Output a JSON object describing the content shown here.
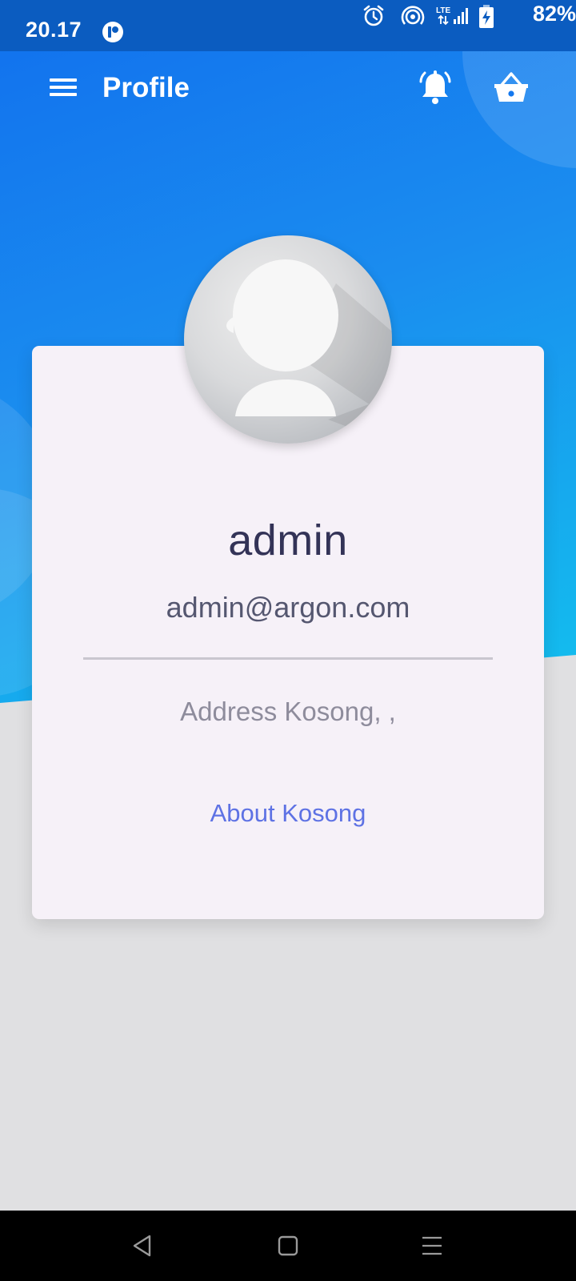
{
  "status_bar": {
    "time": "20.17",
    "battery": "82%",
    "icons": [
      "app-notification-icon",
      "alarm-icon",
      "hotspot-icon",
      "lte-signal-icon",
      "battery-charging-icon"
    ]
  },
  "app_bar": {
    "title": "Profile",
    "menu_icon": "hamburger-menu-icon",
    "notification_icon": "bell-icon",
    "cart_icon": "basket-icon"
  },
  "profile": {
    "name": "admin",
    "email": "admin@argon.com",
    "address": "Address Kosong, ,",
    "about": "About Kosong",
    "avatar_icon": "default-user-avatar"
  },
  "nav_bar": {
    "back_icon": "back-triangle-icon",
    "home_icon": "home-square-icon",
    "recents_icon": "recents-menu-icon"
  },
  "colors": {
    "header_gradient_start": "#1170ee",
    "header_gradient_end": "#13c0ee",
    "card_background": "#f6f1f8",
    "name_text": "#333357",
    "link_text": "#5e72e4",
    "page_background": "#e0e0e2"
  }
}
